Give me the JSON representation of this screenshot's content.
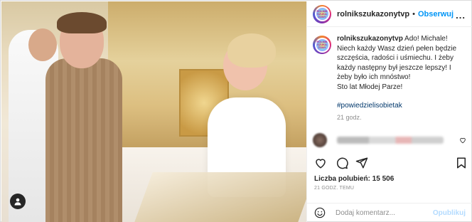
{
  "post": {
    "username": "rolnikszukazonytvp",
    "follow_label": "Obserwuj",
    "dot": "•",
    "more": "...",
    "caption_author": "rolnikszukazonytvp",
    "caption_lines": [
      "Ado! Michale!",
      "Niech każdy Wasz dzień pełen będzie",
      "szczęścia, radości i uśmiechu. I żeby",
      "każdy następny był jeszcze lepszy! I",
      "żeby było ich mnóstwo!",
      "Sto lat Młodej Parze!"
    ],
    "hashtag": "#powiedzielisobietak",
    "caption_time": "21 godz.",
    "likes_label": "Liczba polubień: 15 506",
    "time_ago": "21 GODZ. TEMU",
    "comment_placeholder": "Dodaj komentarz...",
    "publish_label": "Opublikuj"
  },
  "icons": {
    "user_tag": "user-tag-icon",
    "like": "heart-icon",
    "comment": "comment-icon",
    "share": "send-icon",
    "save": "bookmark-icon",
    "emoji": "emoji-icon",
    "comment_like": "heart-icon"
  },
  "colors": {
    "accent": "#0095f6",
    "publish_disabled": "#b3dbff",
    "text": "#262626",
    "muted": "#8e8e8e"
  }
}
